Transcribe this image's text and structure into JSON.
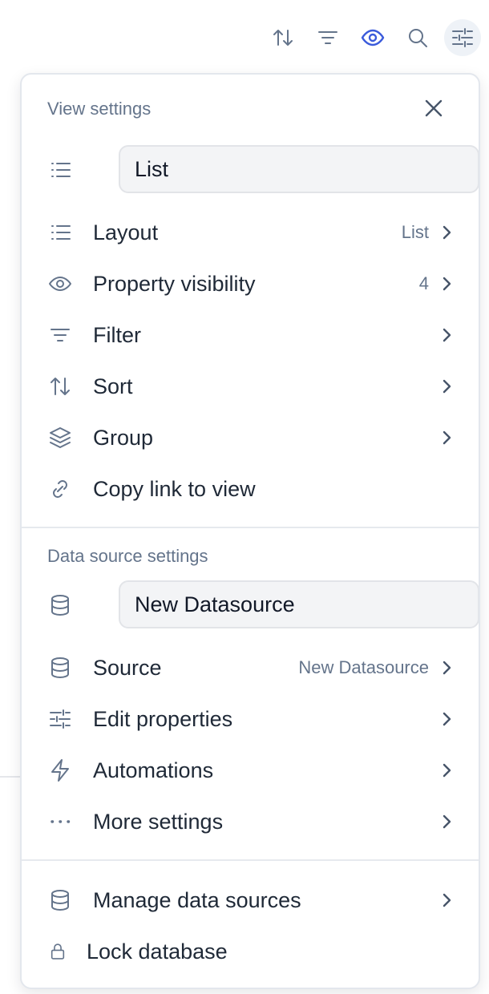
{
  "toolbar": {
    "icons": [
      "sort-icon",
      "filter-icon",
      "eye-icon",
      "search-icon",
      "sliders-icon"
    ],
    "active_color": "#3b5bdb"
  },
  "view_settings": {
    "header": "View settings",
    "name_value": "List",
    "items": [
      {
        "label": "Layout",
        "value": "List",
        "icon": "list-icon"
      },
      {
        "label": "Property visibility",
        "value": "4",
        "icon": "eye-icon"
      },
      {
        "label": "Filter",
        "value": "",
        "icon": "filter-icon"
      },
      {
        "label": "Sort",
        "value": "",
        "icon": "sort-icon"
      },
      {
        "label": "Group",
        "value": "",
        "icon": "layers-icon"
      },
      {
        "label": "Copy link to view",
        "value": "",
        "icon": "link-icon"
      }
    ]
  },
  "data_source_settings": {
    "header": "Data source settings",
    "name_value": "New Datasource",
    "items": [
      {
        "label": "Source",
        "value": "New Datasource",
        "icon": "database-icon"
      },
      {
        "label": "Edit properties",
        "value": "",
        "icon": "sliders-icon"
      },
      {
        "label": "Automations",
        "value": "",
        "icon": "lightning-icon"
      },
      {
        "label": "More settings",
        "value": "",
        "icon": "more-dots-icon"
      }
    ]
  },
  "footer": {
    "items": [
      {
        "label": "Manage data sources",
        "icon": "database-icon"
      },
      {
        "label": "Lock database",
        "icon": "lock-icon"
      }
    ]
  }
}
